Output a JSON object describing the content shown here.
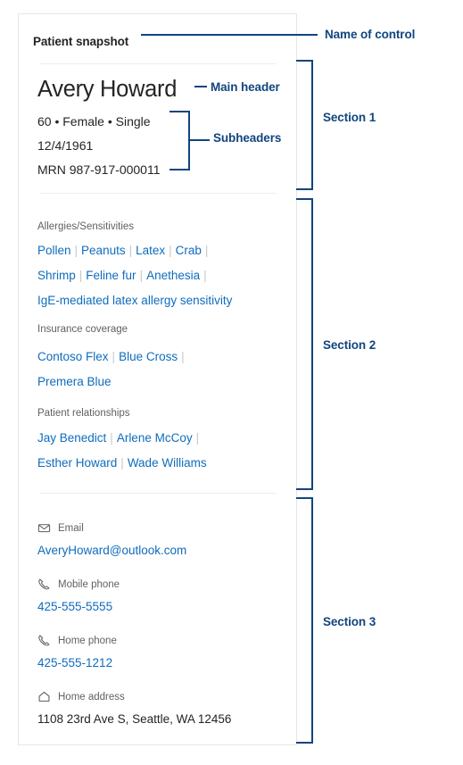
{
  "card": {
    "title": "Patient snapshot",
    "section1": {
      "name": "Avery Howard",
      "demographics": "60 • Female • Single",
      "date_of_birth": "12/4/1961",
      "mrn": "MRN 987-917-000011"
    },
    "section2": {
      "allergies": {
        "label": "Allergies/Sensitivities",
        "line1": [
          "Pollen",
          "Peanuts",
          "Latex",
          "Crab"
        ],
        "line2": [
          "Shrimp",
          "Feline fur",
          "Anethesia"
        ],
        "line3": [
          "IgE-mediated latex allergy sensitivity"
        ]
      },
      "insurance": {
        "label": "Insurance coverage",
        "line1": [
          "Contoso Flex",
          "Blue Cross"
        ],
        "line2": [
          "Premera Blue"
        ]
      },
      "relationships": {
        "label": "Patient relationships",
        "line1": [
          "Jay Benedict",
          "Arlene McCoy"
        ],
        "line2": [
          "Esther Howard",
          "Wade Williams"
        ]
      }
    },
    "section3": {
      "email": {
        "label": "Email",
        "icon": "envelope-icon",
        "value": "AveryHoward@outlook.com"
      },
      "mobile_phone": {
        "label": "Mobile phone",
        "icon": "phone-icon",
        "value": "425-555-5555"
      },
      "home_phone": {
        "label": "Home phone",
        "icon": "phone-icon",
        "value": "425-555-1212"
      },
      "home_address": {
        "label": "Home address",
        "icon": "home-icon",
        "value": "1108 23rd Ave S, Seattle, WA 12456"
      }
    }
  },
  "annotations": {
    "name_of_control": "Name of control",
    "main_header": "Main header",
    "subheaders": "Subheaders",
    "section_1": "Section 1",
    "section_2": "Section 2",
    "section_3": "Section 3"
  },
  "colors": {
    "link": "#0f6cbd",
    "annotation": "#11457e",
    "text": "#242424",
    "secondary_text": "#616161",
    "divider": "#ededed",
    "card_border": "#e6e6e6"
  }
}
